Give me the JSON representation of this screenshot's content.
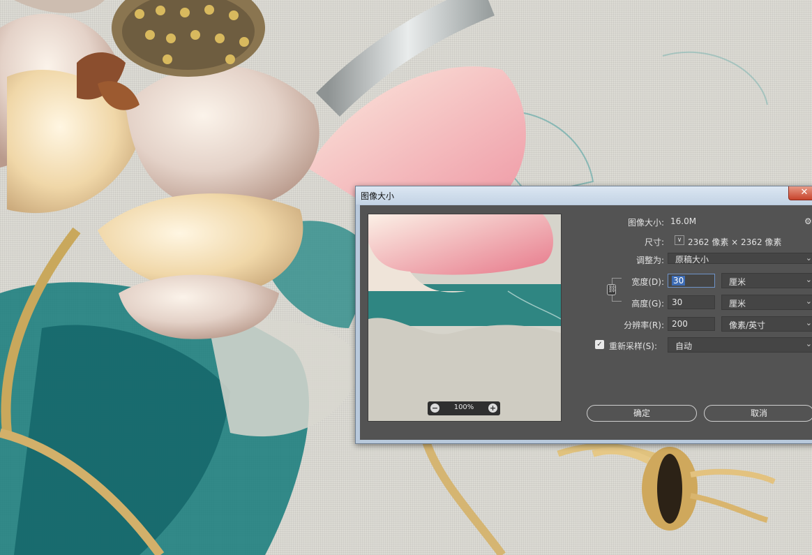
{
  "dialog": {
    "title": "图像大小",
    "close_glyph": "✕",
    "image_size_label": "图像大小:",
    "image_size_value": "16.0M",
    "settings_icon": "gear-icon",
    "dimensions_label": "尺寸:",
    "dimensions_value": "2362 像素 × 2362 像素",
    "fit_to_label": "调整为:",
    "fit_to_value": "原稿大小",
    "width_label": "宽度(D):",
    "width_value": "30",
    "width_unit": "厘米",
    "height_label": "高度(G):",
    "height_value": "30",
    "height_unit": "厘米",
    "resolution_label": "分辨率(R):",
    "resolution_value": "200",
    "resolution_unit": "像素/英寸",
    "resample_checked": true,
    "resample_label": "重新采样(S):",
    "resample_value": "自动",
    "zoom_value": "100%",
    "ok_label": "确定",
    "cancel_label": "取消"
  },
  "colors": {
    "panel": "#535353",
    "frame": "#b8c9dc",
    "close_button": "#c7432c",
    "selection": "#3d6cb5"
  }
}
